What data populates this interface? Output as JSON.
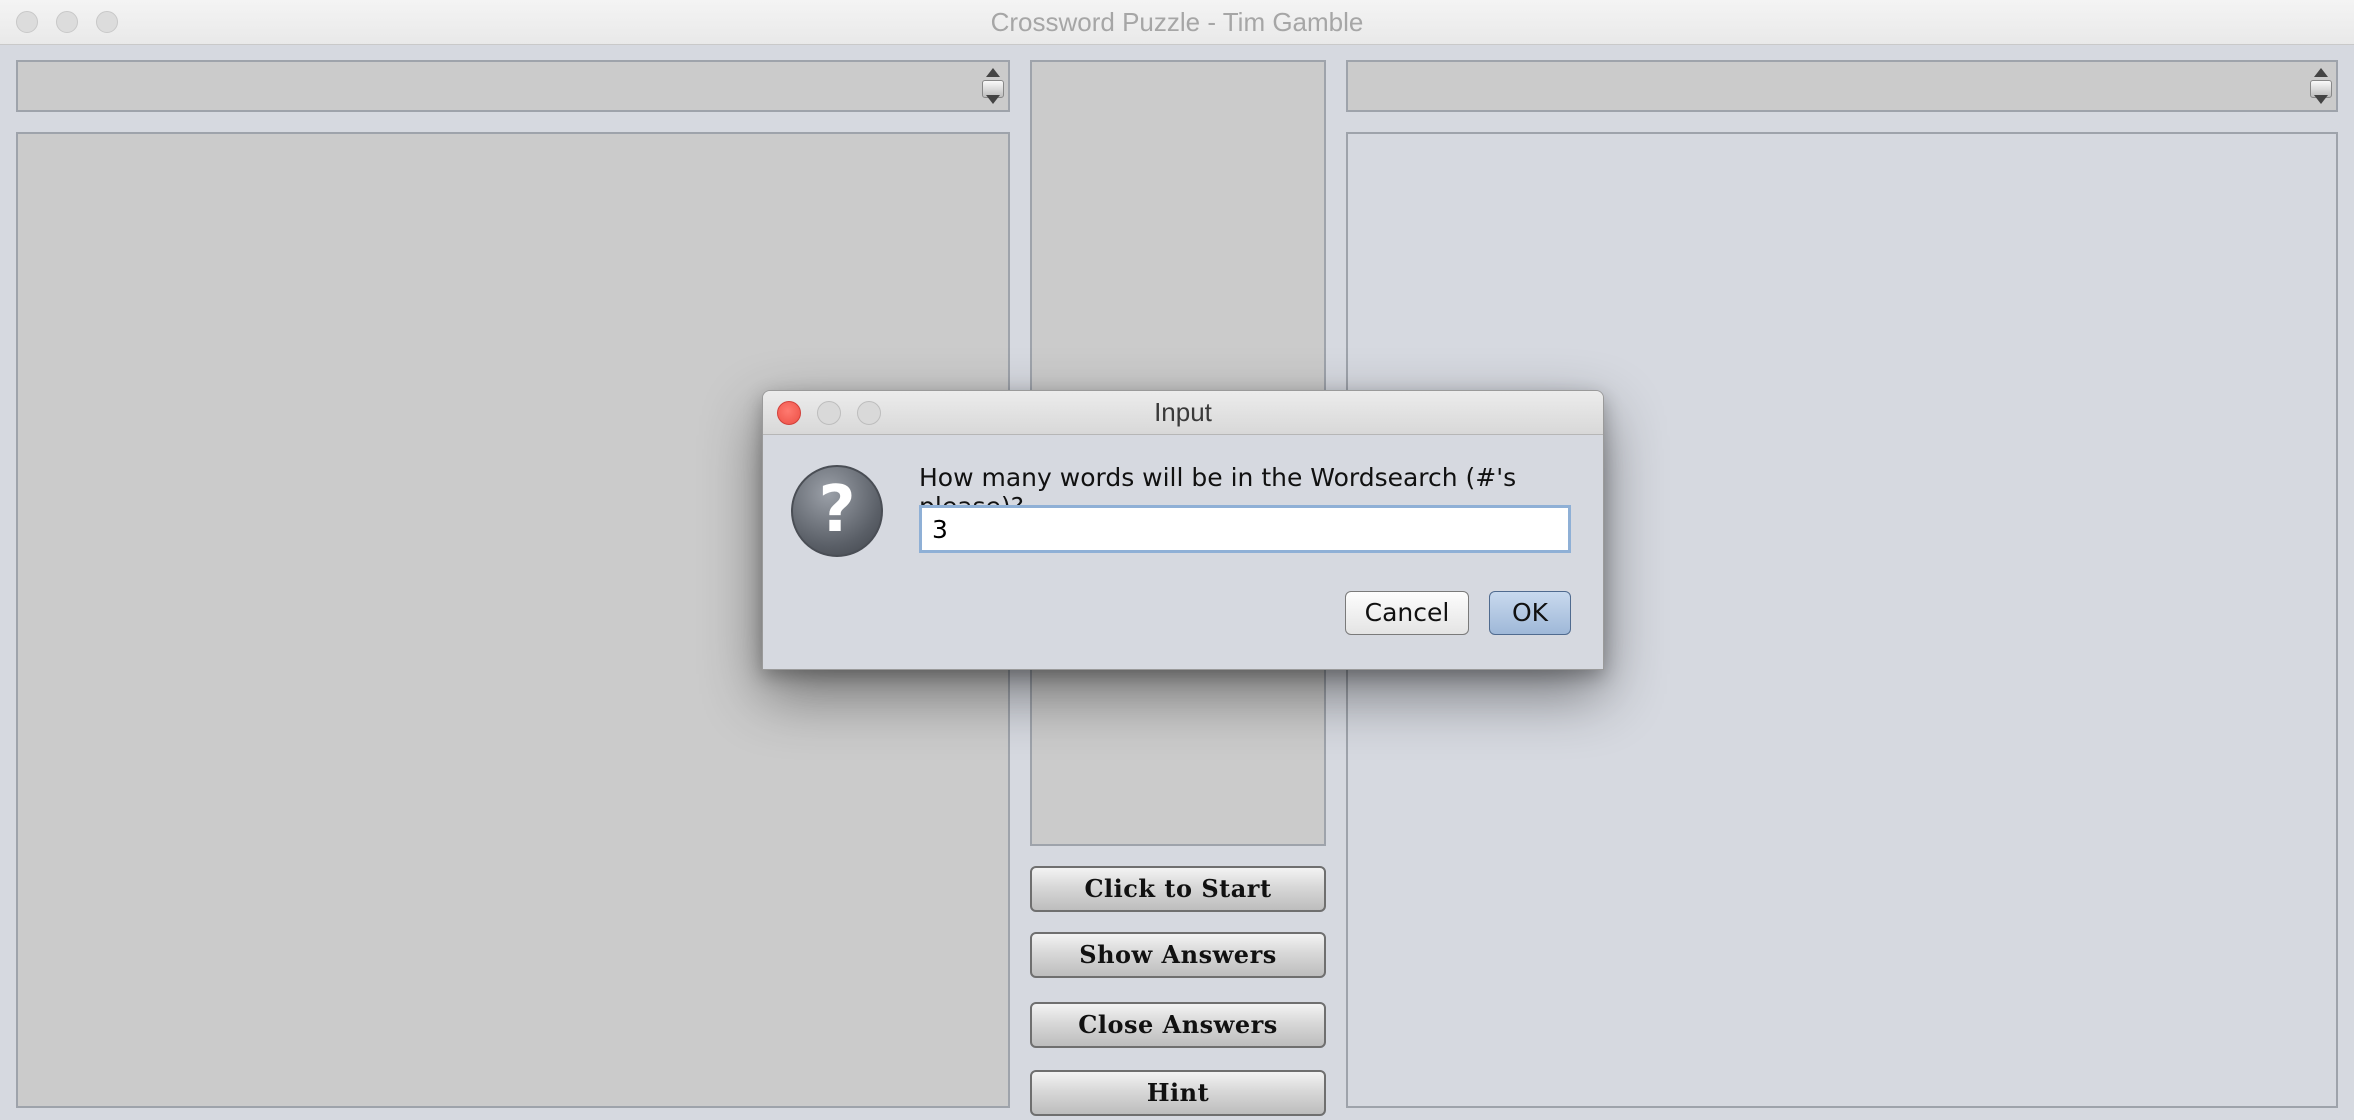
{
  "window": {
    "title": "Crossword Puzzle - Tim Gamble"
  },
  "buttons": {
    "start": "Click to Start",
    "show_answers": "Show Answers",
    "close_answers": "Close Answers",
    "hint": "Hint"
  },
  "dialog": {
    "title": "Input",
    "prompt": "How many words will be in the Wordsearch (#'s please)?",
    "input_value": "3",
    "cancel_label": "Cancel",
    "ok_label": "OK"
  },
  "icons": {
    "dialog": "question-icon"
  },
  "colors": {
    "window_bg": "#d6d9e0",
    "panel_bg": "#cbcbcb",
    "close_red": "#ec4f45",
    "focus_blue": "#8fb0d6"
  }
}
